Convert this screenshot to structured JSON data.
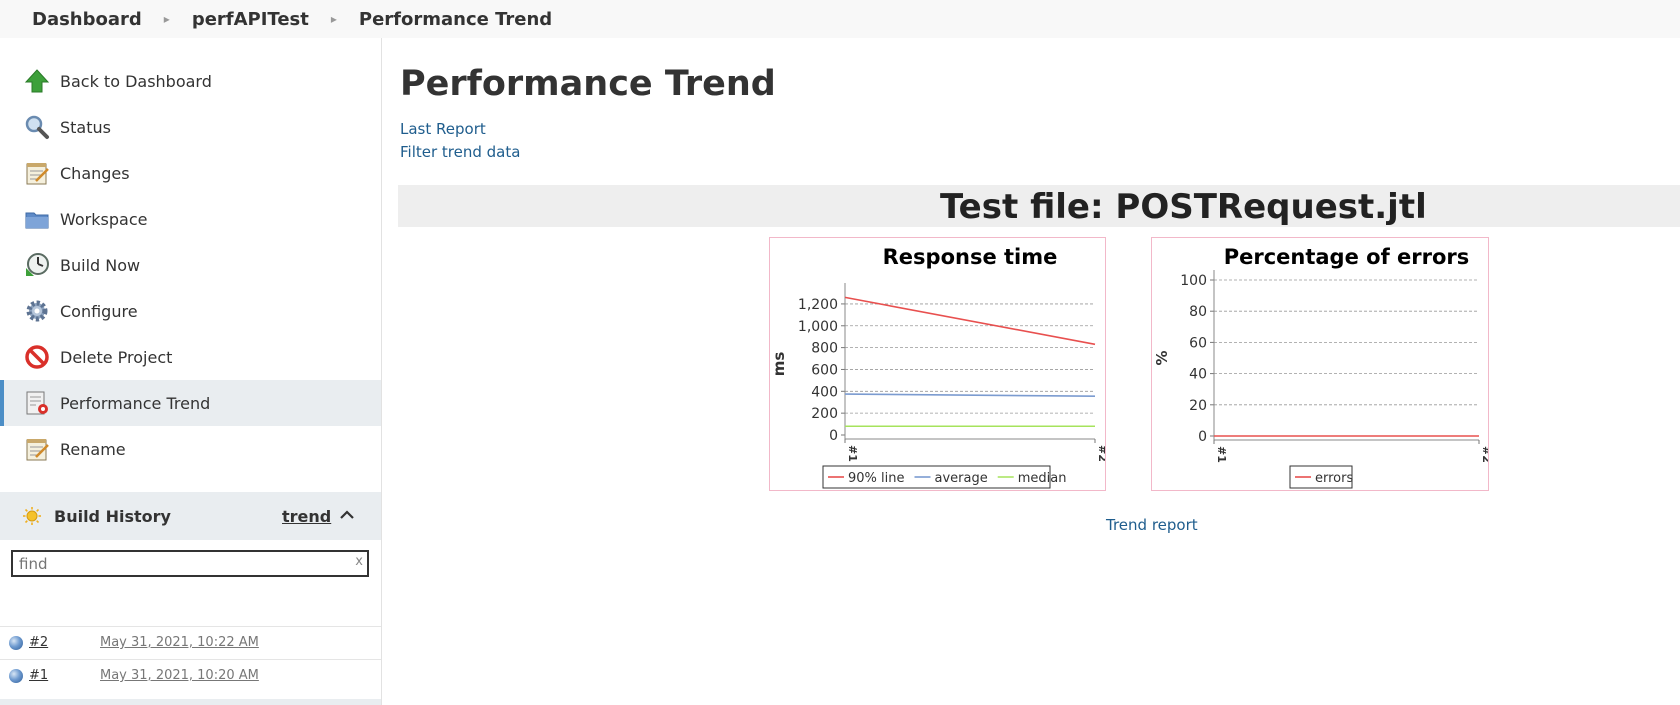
{
  "breadcrumb": [
    "Dashboard",
    "perfAPITest",
    "Performance Trend"
  ],
  "sidebar": {
    "tasks": [
      {
        "label": "Back to Dashboard",
        "icon": "up-arrow-icon"
      },
      {
        "label": "Status",
        "icon": "magnifier-icon"
      },
      {
        "label": "Changes",
        "icon": "notepad-icon"
      },
      {
        "label": "Workspace",
        "icon": "folder-icon"
      },
      {
        "label": "Build Now",
        "icon": "clock-icon"
      },
      {
        "label": "Configure",
        "icon": "gear-icon"
      },
      {
        "label": "Delete Project",
        "icon": "no-entry-icon"
      },
      {
        "label": "Performance Trend",
        "icon": "report-icon"
      },
      {
        "label": "Rename",
        "icon": "notepad-icon"
      }
    ],
    "active_task": "Performance Trend",
    "build_history": {
      "title": "Build History",
      "trend_label": "trend",
      "search_placeholder": "find",
      "clear_label": "x",
      "builds": [
        {
          "number": "#2",
          "date": "May 31, 2021, 10:22 AM"
        },
        {
          "number": "#1",
          "date": "May 31, 2021, 10:20 AM"
        }
      ]
    }
  },
  "main": {
    "title": "Performance Trend",
    "links": [
      "Last Report",
      "Filter trend data"
    ],
    "test_file_title": "Test file: POSTRequest.jtl",
    "trend_report_link": "Trend report"
  },
  "chart_data": [
    {
      "type": "line",
      "title": "Response time",
      "ylabel": "ms",
      "xlabel": "",
      "categories": [
        "#1",
        "#2"
      ],
      "ylim": [
        0,
        1300
      ],
      "yticks": [
        0,
        200,
        400,
        600,
        800,
        1000,
        1200
      ],
      "ytick_labels": [
        "0",
        "200",
        "400",
        "600",
        "800",
        "1,000",
        "1,200"
      ],
      "grid": true,
      "legend": "bottom",
      "series": [
        {
          "name": "90% line",
          "values": [
            1260,
            830
          ],
          "color": "#e8504f"
        },
        {
          "name": "average",
          "values": [
            375,
            355
          ],
          "color": "#7b9bd0"
        },
        {
          "name": "median",
          "values": [
            80,
            80
          ],
          "color": "#a6e35c"
        }
      ]
    },
    {
      "type": "line",
      "title": "Percentage of errors",
      "ylabel": "%",
      "xlabel": "",
      "categories": [
        "#1",
        "#2"
      ],
      "ylim": [
        0,
        100
      ],
      "yticks": [
        0,
        20,
        40,
        60,
        80,
        100
      ],
      "ytick_labels": [
        "0",
        "20",
        "40",
        "60",
        "80",
        "100"
      ],
      "grid": true,
      "legend": "bottom",
      "series": [
        {
          "name": "errors",
          "values": [
            0,
            0
          ],
          "color": "#e8504f"
        }
      ]
    }
  ]
}
